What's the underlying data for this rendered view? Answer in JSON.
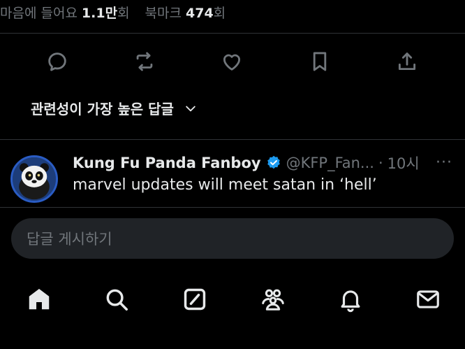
{
  "stats": {
    "likes_label": "마음에 들어요",
    "likes_value": "1.1만",
    "likes_unit": "회",
    "bookmarks_label": "북마크",
    "bookmarks_value": "474",
    "bookmarks_unit": "회"
  },
  "actions": [
    {
      "icon": "reply-icon"
    },
    {
      "icon": "repost-icon"
    },
    {
      "icon": "like-icon"
    },
    {
      "icon": "bookmark-icon"
    },
    {
      "icon": "share-icon"
    }
  ],
  "sort": {
    "label": "관련성이 가장 높은 답글",
    "icon": "chevron-down-icon"
  },
  "reply": {
    "name": "Kung Fu Panda Fanboy",
    "handle": "@KFP_Fan...",
    "separator": "·",
    "time": "10시",
    "text": "marvel updates will meet satan in ‘hell’",
    "more": "···"
  },
  "compose": {
    "placeholder": "답글 게시하기"
  },
  "tabbar": [
    {
      "icon": "home-icon"
    },
    {
      "icon": "search-icon"
    },
    {
      "icon": "grok-icon"
    },
    {
      "icon": "communities-icon"
    },
    {
      "icon": "notifications-icon"
    },
    {
      "icon": "messages-icon"
    }
  ],
  "colors": {
    "background": "#000000",
    "text": "#e7e9ea",
    "muted": "#71767b",
    "divider": "#2f3336",
    "verified": "#1d9bf0",
    "compose_bg": "#202327"
  }
}
